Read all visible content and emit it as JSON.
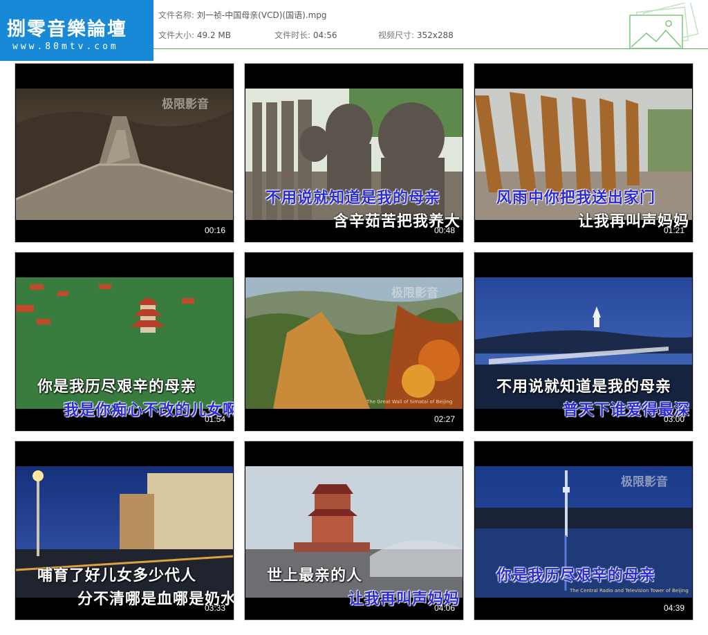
{
  "logo": {
    "title": "捌零音樂論壇",
    "url": "www.80mtv.com"
  },
  "info": {
    "filename_label": "文件名称:",
    "filename": "刘一祯-中国母亲(VCD)(国语).mpg",
    "size_label": "文件大小:",
    "size": "49.2 MB",
    "duration_label": "文件时长:",
    "duration": "04:56",
    "dims_label": "视频尺寸:",
    "dims": "352x288"
  },
  "thumbnails": [
    {
      "time": "00:16",
      "scene": "great-wall-dusk",
      "lines": [],
      "watermark": "极限影音",
      "caption": ""
    },
    {
      "time": "00:48",
      "scene": "stone-lions",
      "lines": [
        "不用说就知道是我的母亲",
        "含辛茹苦把我养大"
      ],
      "watermark": "",
      "caption": ""
    },
    {
      "time": "01:21",
      "scene": "sculptures",
      "lines": [
        "风雨中你把我送出家门",
        "让我再叫声妈妈"
      ],
      "watermark": "",
      "caption": ""
    },
    {
      "time": "01:54",
      "scene": "palace-forest",
      "lines": [
        "你是我历尽艰辛的母亲",
        "我是你痴心不改的儿女啊"
      ],
      "watermark": "",
      "caption": ""
    },
    {
      "time": "02:27",
      "scene": "autumn-wall",
      "lines": [],
      "watermark": "极限影音",
      "caption": "The Great Wall of Simatai of Beijing"
    },
    {
      "time": "03:00",
      "scene": "night-bridge",
      "lines": [
        "不用说就知道是我的母亲",
        "普天下谁爱得最深"
      ],
      "watermark": "",
      "caption": ""
    },
    {
      "time": "03:33",
      "scene": "night-street",
      "lines": [
        "哺育了好儿女多少代人",
        "分不清哪是血哪是奶水"
      ],
      "watermark": "",
      "caption": ""
    },
    {
      "time": "04:06",
      "scene": "gate-tower",
      "lines": [
        "世上最亲的人",
        "让我再叫声妈妈"
      ],
      "watermark": "",
      "caption": ""
    },
    {
      "time": "04:39",
      "scene": "tv-tower",
      "lines": [
        "你是我历尽艰辛的母亲"
      ],
      "watermark": "极限影音",
      "caption": "The Central Radio and Television Tower of Beijing"
    }
  ],
  "colors": {
    "header_line": "#4caf50",
    "logo_bg": "#1789d6",
    "lyric_blue": "#2b2bd8"
  }
}
